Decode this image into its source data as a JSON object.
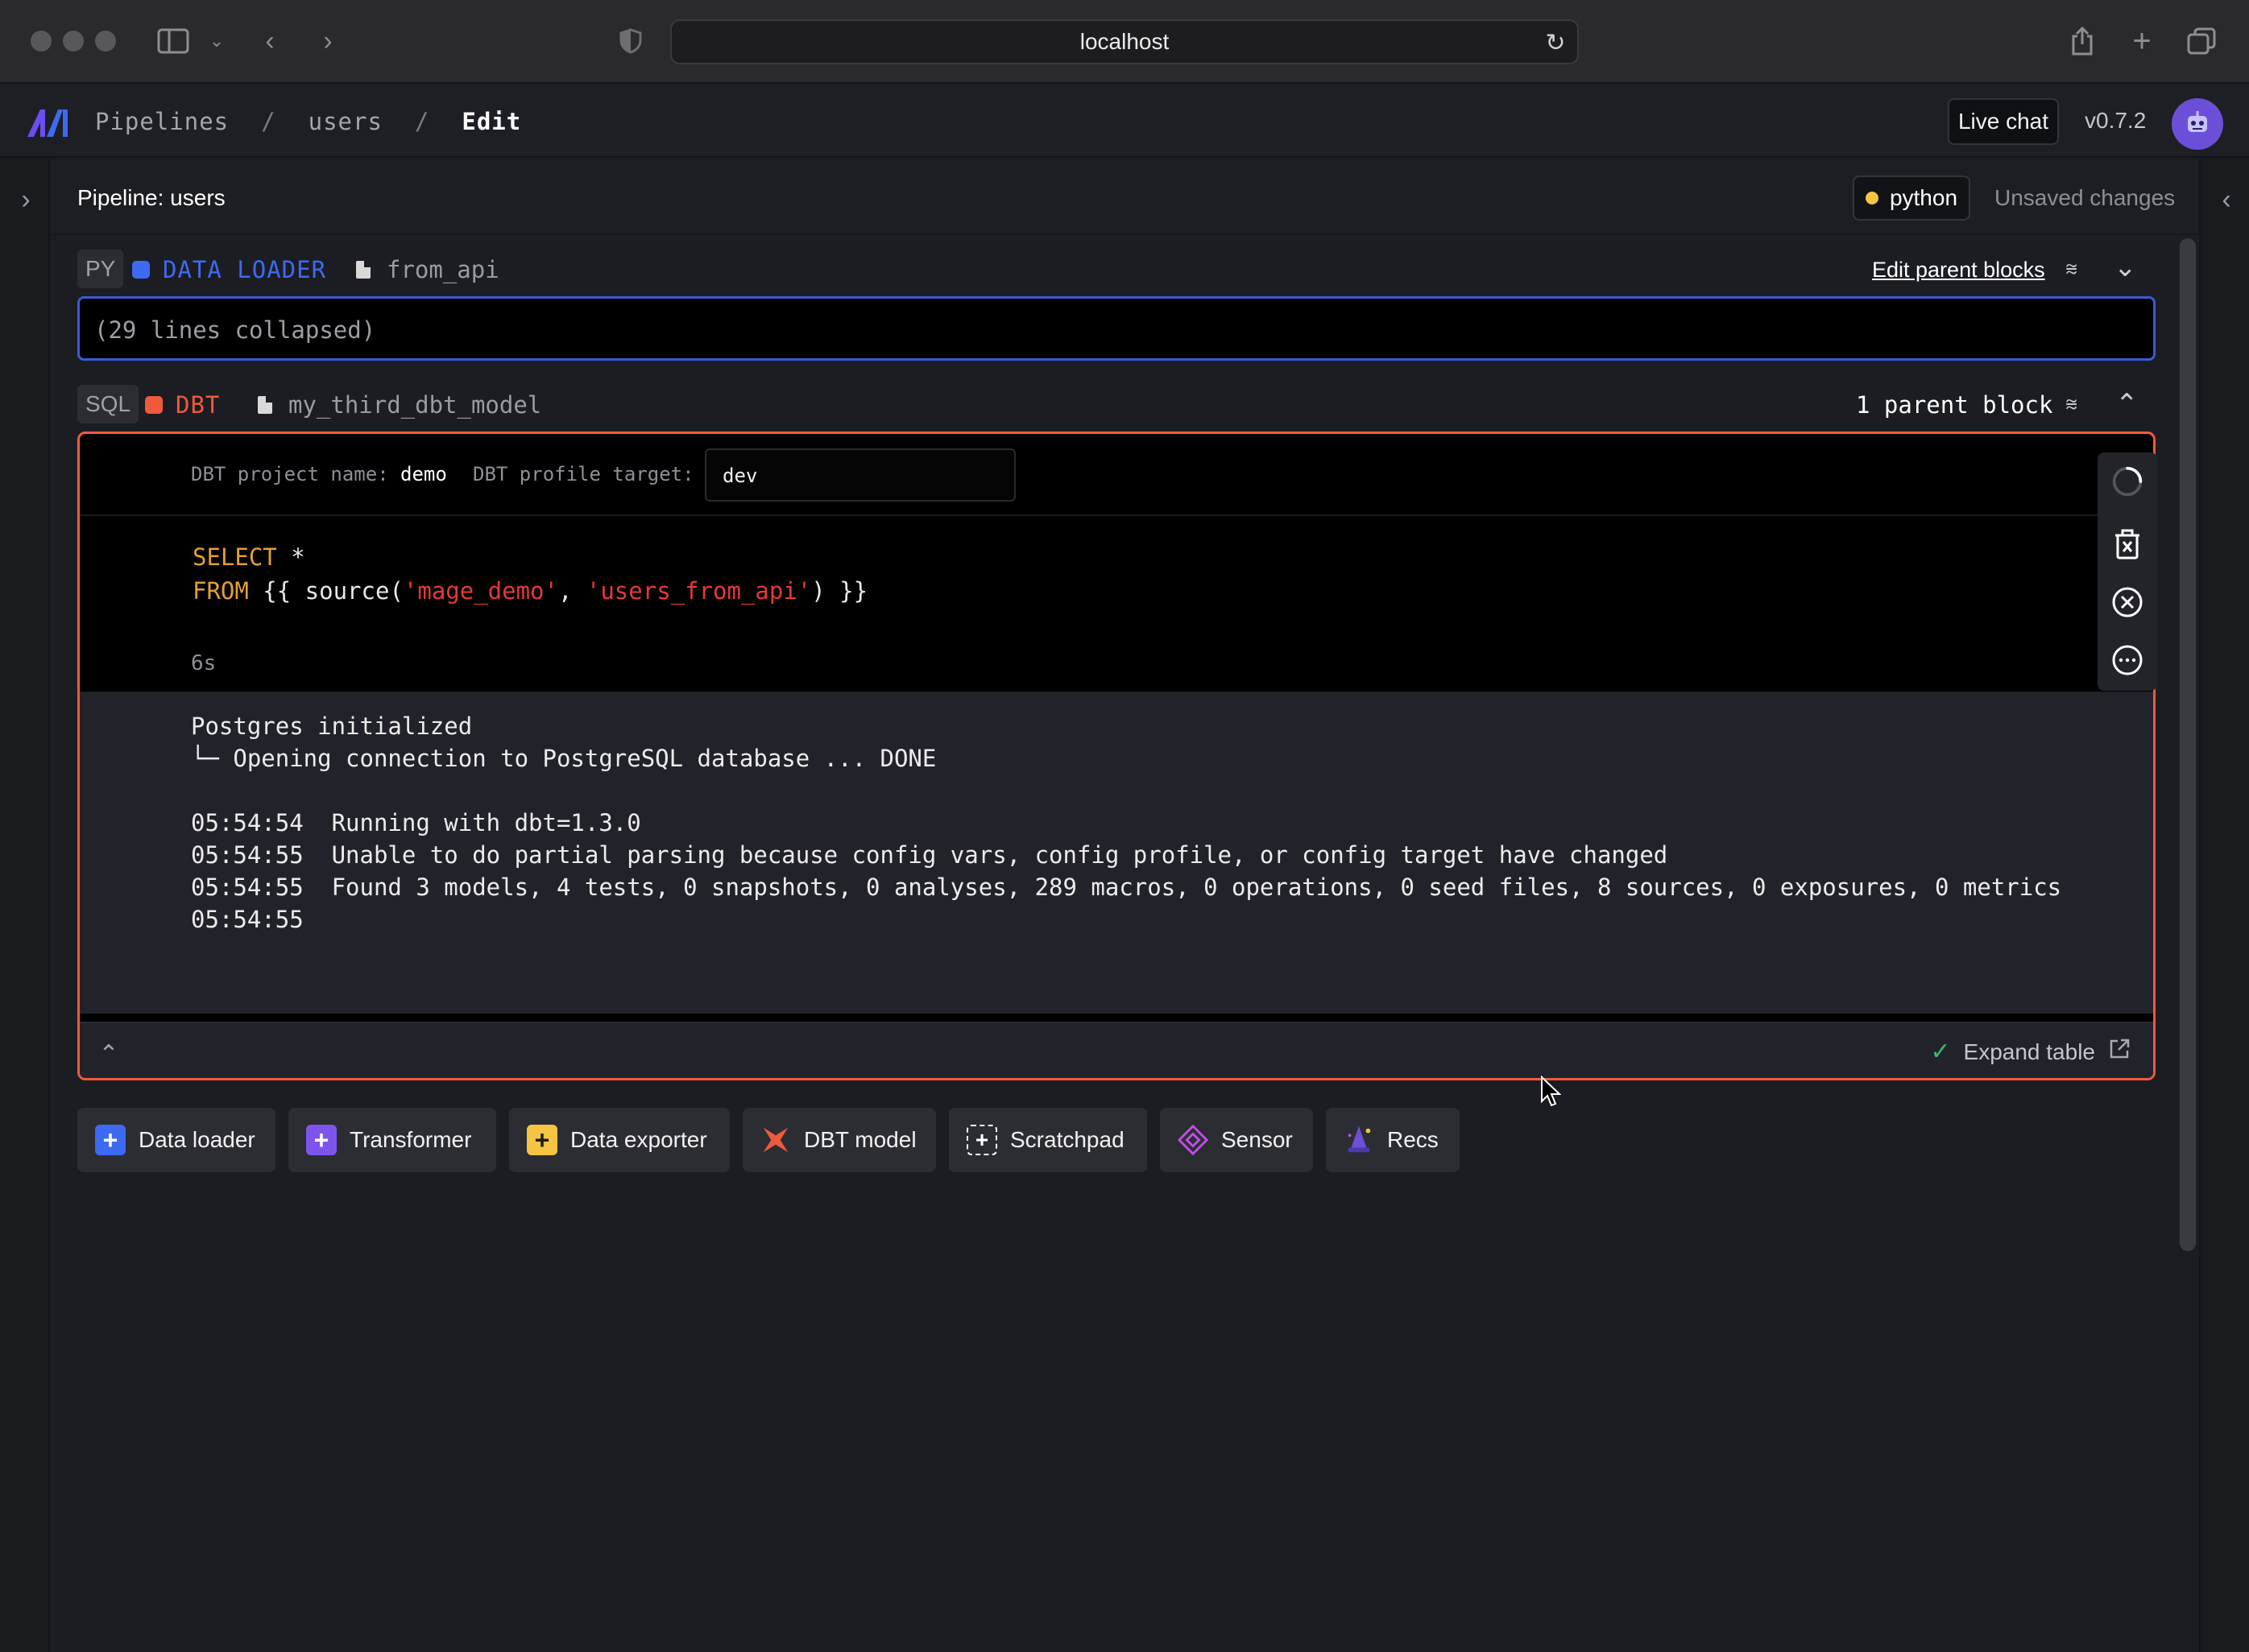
{
  "browser": {
    "url": "localhost"
  },
  "header": {
    "breadcrumbs": [
      "Pipelines",
      "users",
      "Edit"
    ],
    "live_chat": "Live chat",
    "version": "v0.7.2"
  },
  "pipeline": {
    "title": "Pipeline: users",
    "language_badge": "python",
    "status": "Unsaved changes"
  },
  "blocks": [
    {
      "lang": "PY",
      "type": "DATA LOADER",
      "type_color": "#3d6af2",
      "name": "from_api",
      "action": "Edit parent blocks",
      "collapsed_text": "(29 lines collapsed)"
    },
    {
      "lang": "SQL",
      "type": "DBT",
      "type_color": "#f05a3c",
      "name": "my_third_dbt_model",
      "parents": "1 parent block",
      "project_label": "DBT project name:",
      "project_value": "demo",
      "profile_label": "DBT profile target:",
      "profile_value": "dev",
      "code": {
        "line1_kw": "SELECT",
        "line1_rest": " *",
        "line2_kw": "FROM",
        "line2_a": " {{ source(",
        "line2_s1": "'mage_demo'",
        "line2_b": ", ",
        "line2_s2": "'users_from_api'",
        "line2_c": ") }}"
      },
      "runtime": "6s",
      "output": [
        "Postgres initialized",
        "└─ Opening connection to PostgreSQL database ... DONE",
        "",
        "05:54:54  Running with dbt=1.3.0",
        "05:54:55  Unable to do partial parsing because config vars, config profile, or config target have changed",
        "05:54:55  Found 3 models, 4 tests, 0 snapshots, 0 analyses, 289 macros, 0 operations, 0 seed files, 8 sources, 0 exposures, 0 metrics",
        "05:54:55"
      ],
      "expand_label": "Expand table"
    }
  ],
  "add_buttons": [
    {
      "label": "Data loader",
      "icon": "plus-icon",
      "color": "#3d6af2"
    },
    {
      "label": "Transformer",
      "icon": "plus-icon",
      "color": "#7d55ec"
    },
    {
      "label": "Data exporter",
      "icon": "plus-icon",
      "color": "#f6c443"
    },
    {
      "label": "DBT model",
      "icon": "dbt-icon",
      "color": "#f05a3c"
    },
    {
      "label": "Scratchpad",
      "icon": "plus-square-icon",
      "color": "#ffffff"
    },
    {
      "label": "Sensor",
      "icon": "sensor-icon",
      "color": "#c24ee8"
    },
    {
      "label": "Recs",
      "icon": "wizard-icon",
      "color": "#6b4fd8"
    }
  ]
}
